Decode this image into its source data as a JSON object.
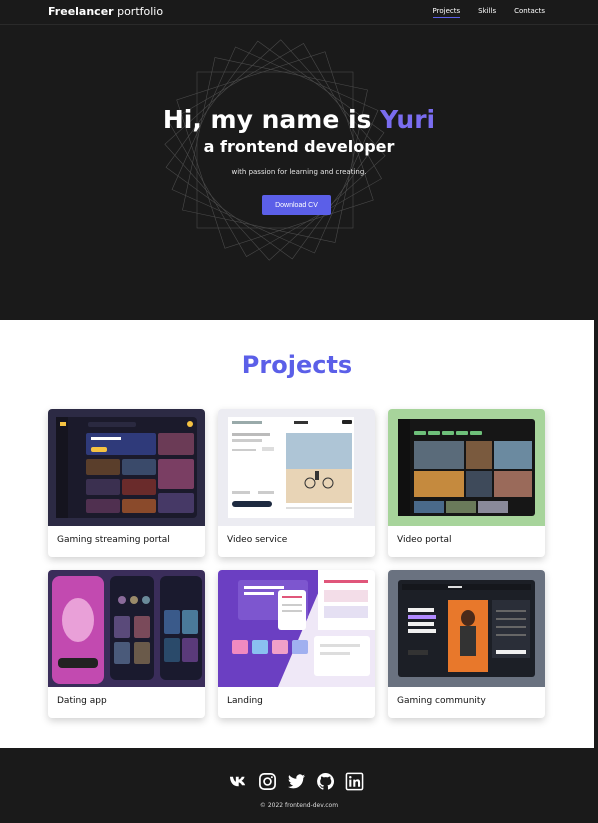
{
  "nav": {
    "logo_bold": "Freelancer",
    "logo_light": " portfolio",
    "links": [
      "Projects",
      "Skills",
      "Contacts"
    ]
  },
  "hero": {
    "greeting": "Hi, my name is ",
    "name": "Yuri",
    "subtitle": "a frontend developer",
    "description": "with passion for learning and creating.",
    "button_label": "Download CV",
    "accent_color": "#7a6df0"
  },
  "projects": {
    "title": "Projects",
    "cards": [
      {
        "title": "Gaming streaming portal"
      },
      {
        "title": "Video service"
      },
      {
        "title": "Video portal"
      },
      {
        "title": "Dating app"
      },
      {
        "title": "Landing"
      },
      {
        "title": "Gaming community"
      }
    ]
  },
  "footer": {
    "social_icons": [
      "vk-icon",
      "instagram-icon",
      "twitter-icon",
      "github-icon",
      "linkedin-icon"
    ],
    "copyright": "© 2022 frontend-dev.com"
  },
  "colors": {
    "brand": "#5b5fe8",
    "background": "#1a1a1a"
  }
}
